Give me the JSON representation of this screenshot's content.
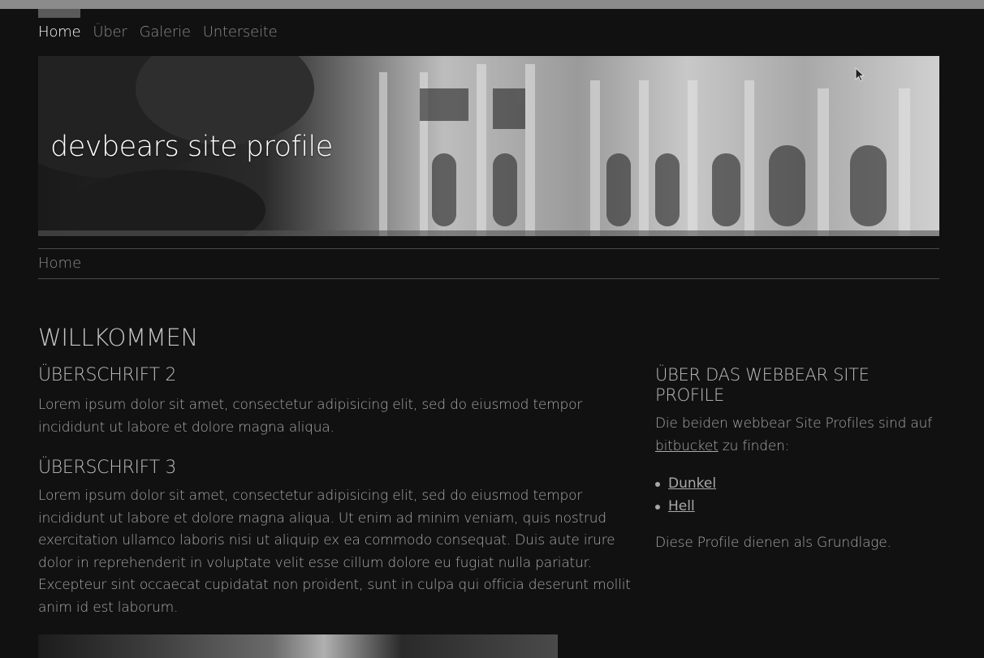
{
  "nav": {
    "items": [
      "Home",
      "Über",
      "Galerie",
      "Unterseite"
    ],
    "active": 0
  },
  "banner": {
    "title": "devbears site profile"
  },
  "breadcrumb": {
    "current": "Home"
  },
  "main": {
    "heading": "WILLKOMMEN",
    "h2": "ÜBERSCHRIFT 2",
    "p1": "Lorem ipsum dolor sit amet, consectetur adipisicing elit, sed do eiusmod tempor incididunt ut labore et dolore magna aliqua.",
    "h3": "ÜBERSCHRIFT 3",
    "p2": "Lorem ipsum dolor sit amet, consectetur adipisicing elit, sed do eiusmod tempor incididunt ut labore et dolore magna aliqua. Ut enim ad minim veniam, quis nostrud exercitation ullamco laboris nisi ut aliquip ex ea commodo consequat. Duis aute irure dolor in reprehenderit in voluptate velit esse cillum dolore eu fugiat nulla pariatur. Excepteur sint occaecat cupidatat non proident, sunt in culpa qui officia deserunt mollit anim id est laborum."
  },
  "sidebar": {
    "heading": "ÜBER DAS WEBBEAR SITE PROFILE",
    "intro_before": "Die beiden webbear Site Profiles sind auf ",
    "intro_link": "bitbucket",
    "intro_after": " zu finden:",
    "links": [
      "Dunkel",
      "Hell"
    ],
    "footer": "Diese Profile dienen als Grundlage."
  },
  "colors": {
    "background": "#111111",
    "text": "#a8a8a8",
    "nav_active": "#ffffff",
    "nav_inactive": "#8c8c8c"
  }
}
